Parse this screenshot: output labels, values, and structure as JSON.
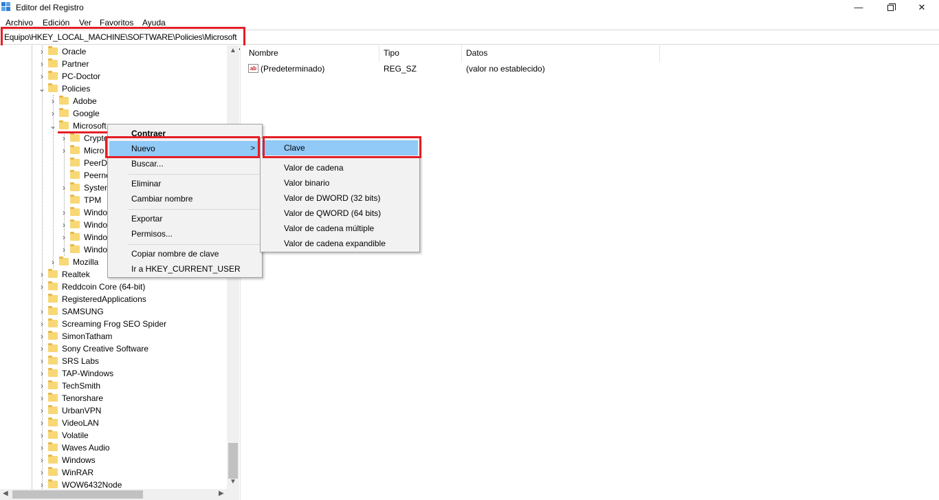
{
  "window": {
    "title": "Editor del Registro",
    "buttons": {
      "minimize": "—",
      "close": "✕"
    }
  },
  "menubar": [
    "Archivo",
    "Edición",
    "Ver",
    "Favoritos",
    "Ayuda"
  ],
  "address": "Equipo\\HKEY_LOCAL_MACHINE\\SOFTWARE\\Policies\\Microsoft",
  "tree": [
    {
      "label": "Oracle",
      "expander": ">"
    },
    {
      "label": "Partner",
      "expander": ">"
    },
    {
      "label": "PC-Doctor",
      "expander": ">"
    },
    {
      "label": "Policies",
      "expander": "v"
    },
    {
      "label": "Adobe",
      "expander": ">"
    },
    {
      "label": "Google",
      "expander": ">"
    },
    {
      "label": "Microsoft",
      "expander": "v"
    },
    {
      "label": "Crypto",
      "expander": ">"
    },
    {
      "label": "Micro",
      "expander": ">"
    },
    {
      "label": "PeerDi",
      "expander": ""
    },
    {
      "label": "Peerne",
      "expander": ""
    },
    {
      "label": "System",
      "expander": ">"
    },
    {
      "label": "TPM",
      "expander": ""
    },
    {
      "label": "Windo",
      "expander": ">"
    },
    {
      "label": "Windo",
      "expander": ">"
    },
    {
      "label": "Windo",
      "expander": ">"
    },
    {
      "label": "Windo",
      "expander": ">"
    },
    {
      "label": "Mozilla",
      "expander": ">"
    },
    {
      "label": "Realtek",
      "expander": ">"
    },
    {
      "label": "Reddcoin Core (64-bit)",
      "expander": ">"
    },
    {
      "label": "RegisteredApplications",
      "expander": ""
    },
    {
      "label": "SAMSUNG",
      "expander": ">"
    },
    {
      "label": "Screaming Frog SEO Spider",
      "expander": ">"
    },
    {
      "label": "SimonTatham",
      "expander": ">"
    },
    {
      "label": "Sony Creative Software",
      "expander": ">"
    },
    {
      "label": "SRS Labs",
      "expander": ">"
    },
    {
      "label": "TAP-Windows",
      "expander": ">"
    },
    {
      "label": "TechSmith",
      "expander": ">"
    },
    {
      "label": "Tenorshare",
      "expander": ">"
    },
    {
      "label": "UrbanVPN",
      "expander": ">"
    },
    {
      "label": "VideoLAN",
      "expander": ">"
    },
    {
      "label": "Volatile",
      "expander": ">"
    },
    {
      "label": "Waves Audio",
      "expander": ">"
    },
    {
      "label": "Windows",
      "expander": ">"
    },
    {
      "label": "WinRAR",
      "expander": ">"
    },
    {
      "label": "WOW6432Node",
      "expander": ">"
    }
  ],
  "list": {
    "columns": [
      "Nombre",
      "Tipo",
      "Datos"
    ],
    "rows": [
      {
        "name": "(Predeterminado)",
        "type": "REG_SZ",
        "data": "(valor no establecido)",
        "icon": "ab"
      }
    ]
  },
  "context_menu": {
    "items": [
      "Contraer",
      "Nuevo",
      "Buscar...",
      "Eliminar",
      "Cambiar nombre",
      "Exportar",
      "Permisos...",
      "Copiar nombre de clave",
      "Ir a HKEY_CURRENT_USER"
    ],
    "submenu_arrow": ">"
  },
  "submenu": {
    "items": [
      "Clave",
      "Valor de cadena",
      "Valor binario",
      "Valor de DWORD (32 bits)",
      "Valor de QWORD (64 bits)",
      "Valor de cadena múltiple",
      "Valor de cadena expandible"
    ]
  },
  "scroll": {
    "up": "▲",
    "down": "▼",
    "left": "◀",
    "right": "▶"
  },
  "colors": {
    "highlight_box": "#e41e26",
    "menu_active": "#91c9f7",
    "folder": "#f8d775"
  }
}
